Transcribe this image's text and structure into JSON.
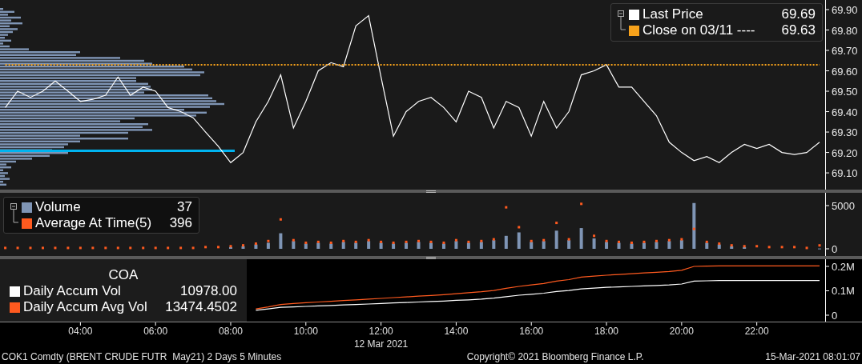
{
  "price_panel": {
    "legend_values": [
      "69.69",
      "69.63"
    ],
    "chart_data": {
      "type": "line",
      "legend": "upper right",
      "xlim": [
        1.86,
        24.8
      ],
      "ylim": [
        69.018,
        69.947
      ],
      "yticks": [
        {
          "value": 69.9,
          "label": "69.90"
        },
        {
          "value": 69.8,
          "label": "69.80"
        },
        {
          "value": 69.7,
          "label": "69.70"
        },
        {
          "value": 69.6,
          "label": "69.60"
        },
        {
          "value": 69.5,
          "label": "69.50"
        },
        {
          "value": 69.4,
          "label": "69.40"
        },
        {
          "value": 69.3,
          "label": "69.30"
        },
        {
          "value": 69.2,
          "label": "69.20"
        },
        {
          "value": 69.1,
          "label": "69.10"
        }
      ],
      "x": [
        2,
        2.33,
        2.67,
        3,
        3.33,
        3.67,
        4,
        4.33,
        4.67,
        5,
        5.33,
        5.67,
        6,
        6.33,
        6.67,
        7,
        7.33,
        7.67,
        8,
        8.33,
        8.67,
        9,
        9.33,
        9.67,
        10,
        10.33,
        10.67,
        11,
        11.33,
        11.67,
        12,
        12.33,
        12.67,
        13,
        13.33,
        13.67,
        14,
        14.33,
        14.67,
        15,
        15.33,
        15.67,
        16,
        16.33,
        16.67,
        17,
        17.33,
        17.67,
        18,
        18.33,
        18.67,
        19,
        19.33,
        19.67,
        20,
        20.33,
        20.67,
        21,
        21.33,
        21.67,
        22,
        22.33,
        22.67,
        23,
        23.33,
        23.67
      ],
      "series": [
        {
          "name": "Last Price",
          "color": "#ffffff",
          "line_style": "solid",
          "values": [
            69.42,
            69.5,
            69.47,
            69.5,
            69.55,
            69.5,
            69.45,
            69.46,
            69.48,
            69.57,
            69.48,
            69.52,
            69.5,
            69.42,
            69.4,
            69.37,
            69.3,
            69.23,
            69.15,
            69.2,
            69.35,
            69.45,
            69.58,
            69.32,
            69.45,
            69.6,
            69.64,
            69.62,
            69.82,
            69.87,
            69.57,
            69.28,
            69.4,
            69.45,
            69.47,
            69.42,
            69.35,
            69.5,
            69.47,
            69.32,
            69.45,
            69.42,
            69.28,
            69.45,
            69.32,
            69.4,
            69.58,
            69.6,
            69.63,
            69.52,
            69.52,
            69.45,
            69.38,
            69.25,
            69.2,
            69.16,
            69.18,
            69.15,
            69.2,
            69.24,
            69.22,
            69.24,
            69.2,
            69.19,
            69.2,
            69.25
          ]
        },
        {
          "name": "Close on 03/11 ----",
          "color": "#f7a21b",
          "line_style": "dashed",
          "values": [
            69.63,
            69.63,
            69.63,
            69.63,
            69.63,
            69.63,
            69.63,
            69.63,
            69.63,
            69.63,
            69.63,
            69.63,
            69.63,
            69.63,
            69.63,
            69.63,
            69.63,
            69.63,
            69.63,
            69.63,
            69.63,
            69.63,
            69.63,
            69.63,
            69.63,
            69.63,
            69.63,
            69.63,
            69.63,
            69.63,
            69.63,
            69.63,
            69.63,
            69.63,
            69.63,
            69.63,
            69.63,
            69.63,
            69.63,
            69.63,
            69.63,
            69.63,
            69.63,
            69.63,
            69.63,
            69.63,
            69.63,
            69.63,
            69.63,
            69.63,
            69.63,
            69.63,
            69.63,
            69.63,
            69.63,
            69.63,
            69.63,
            69.63,
            69.63,
            69.63,
            69.63,
            69.63,
            69.63,
            69.63,
            69.63,
            69.63
          ]
        }
      ]
    }
  },
  "volume_panel": {
    "legend_values": [
      "37",
      "396"
    ],
    "chart_data": {
      "type": "bar",
      "legend": "upper left",
      "xlim": [
        1.86,
        24.8
      ],
      "ylim": [
        -833,
        6481
      ],
      "yticks": [
        {
          "value": 5000,
          "label": "5000"
        },
        {
          "value": 0,
          "label": "0"
        }
      ],
      "x": [
        2,
        2.33,
        2.67,
        3,
        3.33,
        3.67,
        4,
        4.33,
        4.67,
        5,
        5.33,
        5.67,
        6,
        6.33,
        6.67,
        7,
        7.33,
        7.67,
        8,
        8.33,
        8.67,
        9,
        9.33,
        9.67,
        10,
        10.33,
        10.67,
        11,
        11.33,
        11.67,
        12,
        12.33,
        12.67,
        13,
        13.33,
        13.67,
        14,
        14.33,
        14.67,
        15,
        15.33,
        15.67,
        16,
        16.33,
        16.67,
        17,
        17.33,
        17.67,
        18,
        18.33,
        18.67,
        19,
        19.33,
        19.67,
        20,
        20.33,
        20.67,
        21,
        21.33,
        21.67,
        22,
        22.33,
        22.67,
        23,
        23.33,
        23.67
      ],
      "series": [
        {
          "name": "Volume",
          "type": "bar",
          "color": "#7f95b5",
          "values": [
            null,
            null,
            null,
            null,
            null,
            null,
            null,
            null,
            null,
            null,
            null,
            null,
            null,
            null,
            null,
            null,
            null,
            null,
            200,
            300,
            500,
            700,
            1800,
            900,
            600,
            700,
            600,
            800,
            700,
            900,
            700,
            600,
            700,
            800,
            700,
            600,
            900,
            700,
            800,
            1000,
            1500,
            1900,
            800,
            900,
            2100,
            1000,
            2400,
            1200,
            800,
            700,
            600,
            700,
            800,
            900,
            1000,
            5300,
            700,
            500,
            300,
            200,
            null,
            null,
            null,
            null,
            null,
            37
          ]
        },
        {
          "name": "Average At Time(5)",
          "type": "scatter",
          "color": "#ff5a1f",
          "values": [
            100,
            100,
            100,
            100,
            100,
            100,
            100,
            100,
            100,
            100,
            100,
            100,
            100,
            100,
            100,
            100,
            200,
            200,
            300,
            400,
            600,
            900,
            3400,
            1000,
            700,
            800,
            700,
            900,
            800,
            1000,
            800,
            700,
            800,
            900,
            800,
            700,
            1000,
            800,
            900,
            1100,
            4800,
            2500,
            900,
            1000,
            3000,
            1100,
            5200,
            1500,
            900,
            800,
            700,
            800,
            900,
            1000,
            1100,
            2300,
            800,
            600,
            400,
            300,
            300,
            200,
            200,
            200,
            100,
            396
          ]
        }
      ]
    }
  },
  "coa_panel": {
    "title": "COA",
    "legend_values": [
      "10978.00",
      "13474.4502"
    ],
    "chart_data": {
      "type": "line",
      "legend": "lower left",
      "xlim": [
        1.86,
        24.8
      ],
      "ylim": [
        -26230,
        229500
      ],
      "yticks": [
        {
          "value": 200000,
          "label": "0.2M"
        },
        {
          "value": 100000,
          "label": "0.1M"
        },
        {
          "value": 0,
          "label": "0"
        }
      ],
      "xticks": [
        {
          "value": 4,
          "label": "04:00"
        },
        {
          "value": 6,
          "label": "06:00"
        },
        {
          "value": 8,
          "label": "08:00"
        },
        {
          "value": 10,
          "label": "10:00"
        },
        {
          "value": 12,
          "label": "12:00"
        },
        {
          "value": 14,
          "label": "14:00"
        },
        {
          "value": 16,
          "label": "16:00"
        },
        {
          "value": 18,
          "label": "18:00"
        },
        {
          "value": 20,
          "label": "20:00"
        },
        {
          "value": 22,
          "label": "22:00"
        }
      ],
      "xlabel": "12 Mar 2021",
      "x": [
        8.67,
        9,
        9.33,
        9.67,
        10,
        10.33,
        10.67,
        11,
        11.33,
        11.67,
        12,
        12.33,
        12.67,
        13,
        13.33,
        13.67,
        14,
        14.33,
        14.67,
        15,
        15.33,
        15.67,
        16,
        16.33,
        16.67,
        17,
        17.33,
        17.67,
        18,
        18.33,
        18.67,
        19,
        19.33,
        19.67,
        20,
        20.33,
        20.67,
        21,
        21.33,
        21.67,
        22,
        22.33,
        22.67,
        23,
        23.33,
        23.67
      ],
      "series": [
        {
          "name": "Daily Accum Vol",
          "color": "#ffffff",
          "line_style": "solid",
          "values": [
            20000,
            26000,
            32000,
            34000,
            36000,
            38000,
            40000,
            42000,
            44000,
            46000,
            48000,
            50000,
            52000,
            54000,
            56000,
            58000,
            61000,
            63000,
            66000,
            70000,
            76000,
            82000,
            86000,
            90000,
            97000,
            101000,
            108000,
            111000,
            114000,
            116000,
            118000,
            120000,
            122000,
            124000,
            128000,
            140000,
            141000,
            142000,
            142000,
            142000,
            142000,
            142000,
            142000,
            142000,
            142000,
            142000
          ]
        },
        {
          "name": "Daily Accum Avg Vol",
          "color": "#ff5a1f",
          "line_style": "solid",
          "values": [
            26000,
            34000,
            44000,
            48000,
            51000,
            54000,
            57000,
            60000,
            63000,
            66000,
            69000,
            72000,
            75000,
            78000,
            81000,
            84000,
            88000,
            92000,
            96000,
            101000,
            110000,
            118000,
            124000,
            130000,
            140000,
            146000,
            156000,
            160000,
            164000,
            167000,
            170000,
            173000,
            176000,
            179000,
            184000,
            200000,
            201000,
            202000,
            202000,
            202000,
            202000,
            202000,
            202000,
            202000,
            202000,
            202000
          ]
        }
      ]
    }
  },
  "status_bar": {
    "left": "COK1 Comdty (BRENT CRUDE FUTR  May21) 2 Days 5 Minutes",
    "center": "Copyright© 2021 Bloomberg Finance L.P.",
    "right": "15-Mar-2021 08:01:07"
  }
}
